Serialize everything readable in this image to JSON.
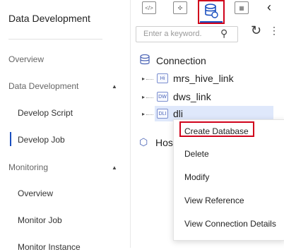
{
  "left_nav": {
    "app_title": "Data Development",
    "items": [
      {
        "label": "Overview"
      },
      {
        "label": "Data Development"
      },
      {
        "label": "Develop Script"
      },
      {
        "label": "Develop Job"
      },
      {
        "label": "Monitoring"
      },
      {
        "label": "Overview"
      },
      {
        "label": "Monitor Job"
      },
      {
        "label": "Monitor Instance"
      }
    ]
  },
  "toolbar": {
    "icons": [
      "script-icon",
      "job-icon",
      "database-icon",
      "table-icon",
      "back-chevron-icon"
    ]
  },
  "search": {
    "placeholder": "Enter a keyword."
  },
  "tree": {
    "root_label": "Connection",
    "children": [
      {
        "badge": "Hi",
        "label": "mrs_hive_link"
      },
      {
        "badge": "DW",
        "label": "dws_link"
      },
      {
        "badge": "DLI",
        "label": "dli"
      }
    ],
    "host_label": "Hos"
  },
  "context_menu": {
    "items": [
      {
        "label": "Create Database"
      },
      {
        "label": "Delete"
      },
      {
        "label": "Modify"
      },
      {
        "label": "View Reference"
      },
      {
        "label": "View Connection Details"
      }
    ]
  },
  "colors": {
    "accent": "#1a4fbf",
    "highlight_red": "#d0021b",
    "selection": "#dfe8fb"
  }
}
